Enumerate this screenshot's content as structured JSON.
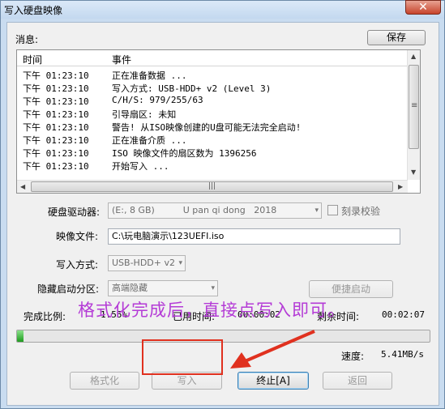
{
  "window": {
    "title": "写入硬盘映像",
    "close_label": "✕"
  },
  "messages": {
    "label": "消息:",
    "save_label": "保存",
    "columns": [
      "时间",
      "事件"
    ],
    "rows": [
      {
        "time": "下午 01:23:10",
        "event": "正在准备数据 ..."
      },
      {
        "time": "下午 01:23:10",
        "event": "写入方式: USB-HDD+ v2 (Level 3)"
      },
      {
        "time": "下午 01:23:10",
        "event": "C/H/S: 979/255/63"
      },
      {
        "time": "下午 01:23:10",
        "event": "引导扇区: 未知"
      },
      {
        "time": "下午 01:23:10",
        "event": "警告! 从ISO映像创建的U盘可能无法完全启动!"
      },
      {
        "time": "下午 01:23:10",
        "event": "正在准备介质 ..."
      },
      {
        "time": "下午 01:23:10",
        "event": "ISO 映像文件的扇区数为 1396256"
      },
      {
        "time": "下午 01:23:10",
        "event": "开始写入 ..."
      }
    ],
    "hscroll_grip": "|||",
    "vscroll_grip": "≡"
  },
  "form": {
    "drive_label": "硬盘驱动器:",
    "drive_value": "(E:, 8 GB)          U pan qi dong   2018",
    "verify_label": "刻录校验",
    "image_label": "映像文件:",
    "image_value": "C:\\玩电脑演示\\123UEFI.iso",
    "write_mode_label": "写入方式:",
    "write_mode_value": "USB-HDD+ v2",
    "hidden_partition_label": "隐藏启动分区:",
    "hidden_partition_value": "高端隐藏",
    "quick_boot_label": "便捷启动"
  },
  "status": {
    "done_label": "完成比例:",
    "done_value": "1.55%",
    "done_fraction": 0.0155,
    "elapsed_label": "已用时间:",
    "elapsed_value": "00:00:02",
    "remaining_label": "剩余时间:",
    "remaining_value": "00:02:07",
    "speed_label": "速度:",
    "speed_value": "5.41MB/s"
  },
  "buttons": {
    "format": "格式化",
    "write": "写入",
    "stop": "终止[A]",
    "back": "返回"
  },
  "annotation": {
    "text": "格式化完成后，直接点写入即可。",
    "color": "#b43bd6",
    "box_color": "#e0311f"
  },
  "icons": {
    "dropdown": "▾",
    "up": "▲",
    "down": "▼",
    "left": "◀",
    "right": "▶"
  }
}
